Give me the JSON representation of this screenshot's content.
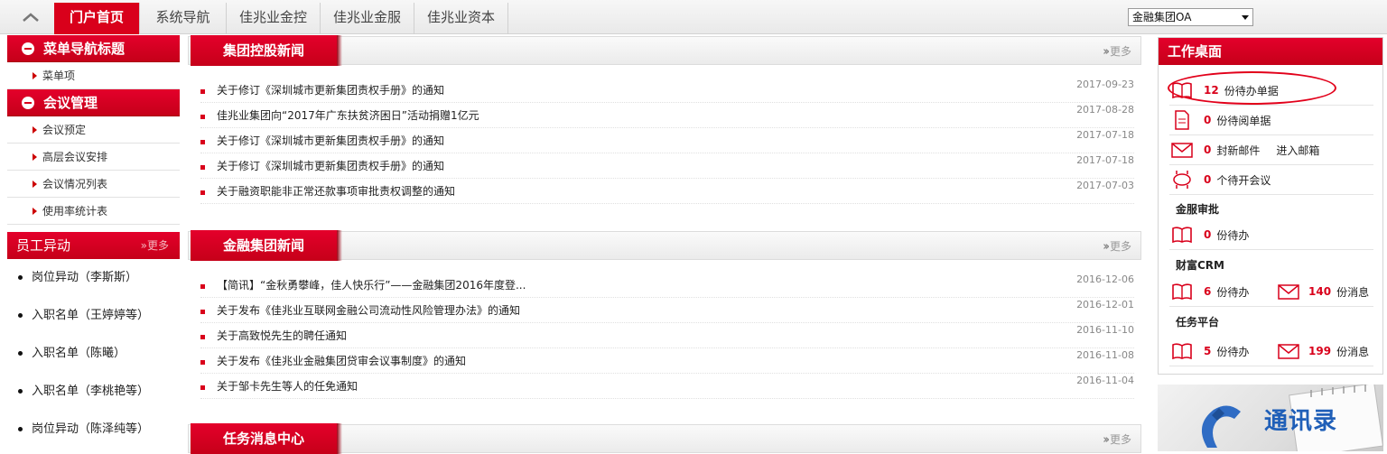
{
  "topbar": {
    "tabs": [
      {
        "label": "门户首页",
        "active": true
      },
      {
        "label": "系统导航"
      },
      {
        "label": "佳兆业金控"
      },
      {
        "label": "佳兆业金服"
      },
      {
        "label": "佳兆业资本"
      }
    ],
    "org_select": "金融集团OA"
  },
  "sidebar": {
    "sections": [
      {
        "title": "菜单导航标题",
        "items": [
          "菜单项"
        ]
      },
      {
        "title": "会议管理",
        "items": [
          "会议预定",
          "高层会议安排",
          "会议情况列表",
          "使用率统计表"
        ]
      }
    ],
    "staff": {
      "title": "员工异动",
      "more": "更多",
      "items": [
        "岗位异动（李斯斯）",
        "入职名单（王婷婷等）",
        "入职名单（陈曦）",
        "入职名单（李桃艳等）",
        "岗位异动（陈泽纯等）"
      ]
    }
  },
  "news": [
    {
      "title": "集团控股新闻",
      "more": "更多",
      "items": [
        {
          "text": "关于修订《深圳城市更新集团责权手册》的通知",
          "date": "2017-09-23"
        },
        {
          "text": "佳兆业集团向“2017年广东扶贫济困日”活动捐赠1亿元",
          "date": "2017-08-28"
        },
        {
          "text": "关于修订《深圳城市更新集团责权手册》的通知",
          "date": "2017-07-18"
        },
        {
          "text": "关于修订《深圳城市更新集团责权手册》的通知",
          "date": "2017-07-18"
        },
        {
          "text": "关于融资职能非正常还款事项审批责权调整的通知",
          "date": "2017-07-03"
        }
      ]
    },
    {
      "title": "金融集团新闻",
      "more": "更多",
      "items": [
        {
          "text": "【简讯】“金秋勇攀峰，佳人快乐行”——金融集团2016年度登...",
          "date": "2016-12-06"
        },
        {
          "text": "关于发布《佳兆业互联网金融公司流动性风险管理办法》的通知",
          "date": "2016-12-01"
        },
        {
          "text": "关于高致悦先生的聘任通知",
          "date": "2016-11-10"
        },
        {
          "text": "关于发布《佳兆业金融集团贷审会议事制度》的通知",
          "date": "2016-11-08"
        },
        {
          "text": "关于邹卡先生等人的任免通知",
          "date": "2016-11-04"
        }
      ]
    },
    {
      "title": "任务消息中心",
      "more": "更多",
      "items": []
    }
  ],
  "workbench": {
    "title": "工作桌面",
    "pending_forms": {
      "count": "12",
      "label": "份待办单据"
    },
    "unread_forms": {
      "count": "0",
      "label": "份待阅单据"
    },
    "mail": {
      "count": "0",
      "label": "封新邮件",
      "link": "进入邮箱"
    },
    "meetings": {
      "count": "0",
      "label": "个待开会议"
    },
    "jinfu": {
      "title": "金服审批",
      "count": "0",
      "label": "份待办"
    },
    "crm": {
      "title": "财富CRM",
      "todo_count": "6",
      "todo_label": "份待办",
      "msg_count": "140",
      "msg_label": "份消息"
    },
    "task": {
      "title": "任务平台",
      "todo_count": "5",
      "todo_label": "份待办",
      "msg_count": "199",
      "msg_label": "份消息"
    }
  },
  "contacts": {
    "label": "通讯录"
  },
  "colors": {
    "brand_red": "#d9001b",
    "link_blue": "#1f5fb8"
  }
}
